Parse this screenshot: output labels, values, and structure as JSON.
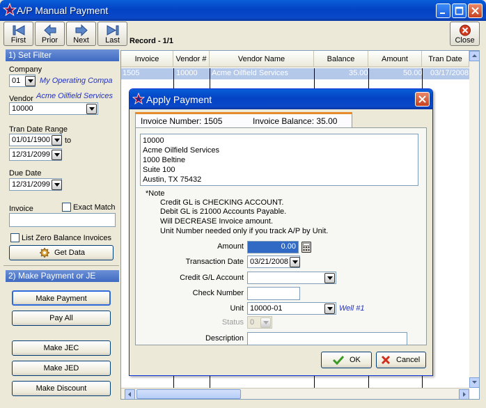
{
  "window": {
    "title": "A/P Manual Payment"
  },
  "toolbar": {
    "first": "First",
    "prior": "Prior",
    "next": "Next",
    "last": "Last",
    "record": "Record - 1/1",
    "close": "Close"
  },
  "filter": {
    "header": "1)  Set Filter",
    "company_label": "Company",
    "company_value": "01",
    "company_name": "My Operating Compa",
    "vendor_label": "Vendor",
    "vendor_name": "Acme Oilfield Services",
    "vendor_value": "10000",
    "tran_range_label": "Tran Date Range",
    "tran_from": "01/01/1900",
    "to_label": "to",
    "tran_to": "12/31/2099",
    "due_label": "Due Date",
    "due_value": "12/31/2099",
    "invoice_label": "Invoice",
    "exact_match": "Exact Match",
    "invoice_value": "",
    "zero_balance": "List Zero Balance Invoices",
    "get_data": "Get Data"
  },
  "payment": {
    "header": "2) Make Payment or JE",
    "make_payment": "Make Payment",
    "pay_all": "Pay All",
    "make_jec": "Make JEC",
    "make_jed": "Make JED",
    "make_discount": "Make Discount"
  },
  "grid": {
    "columns": [
      "Invoice",
      "Vendor #",
      "Vendor Name",
      "Balance",
      "Amount",
      "Tran Date"
    ],
    "rows": [
      {
        "invoice": "1505",
        "vendor": "10000",
        "vendor_name": "Acme Oilfield Services",
        "balance": "35.00",
        "amount": "50.00",
        "tran_date": "03/17/2008"
      }
    ]
  },
  "dialog": {
    "title": "Apply Payment",
    "invoice_number": "Invoice Number: 1505",
    "invoice_balance": "Invoice Balance: 35.00",
    "address": [
      "10000",
      "Acme Oilfield Services",
      "1000 Beltine",
      "Suite 100",
      "Austin, TX 75432"
    ],
    "note_title": "*Note",
    "notes": [
      "Credit GL is CHECKING ACCOUNT.",
      "Debit  GL is 21000 Accounts Payable.",
      "Will DECREASE Invoice amount.",
      "Unit Number needed only if you track A/P by Unit."
    ],
    "amount_label": "Amount",
    "amount_value": "0.00",
    "tran_date_label": "Transaction Date",
    "tran_date_value": "03/21/2008",
    "credit_gl_label": "Credit G/L Account",
    "credit_gl_value": "",
    "check_label": "Check Number",
    "check_value": "",
    "unit_label": "Unit",
    "unit_value": "10000-01",
    "unit_name": "Well #1",
    "status_label": "Status",
    "status_value": "0",
    "description_label": "Description",
    "description_value": "",
    "ok": "OK",
    "cancel": "Cancel"
  }
}
